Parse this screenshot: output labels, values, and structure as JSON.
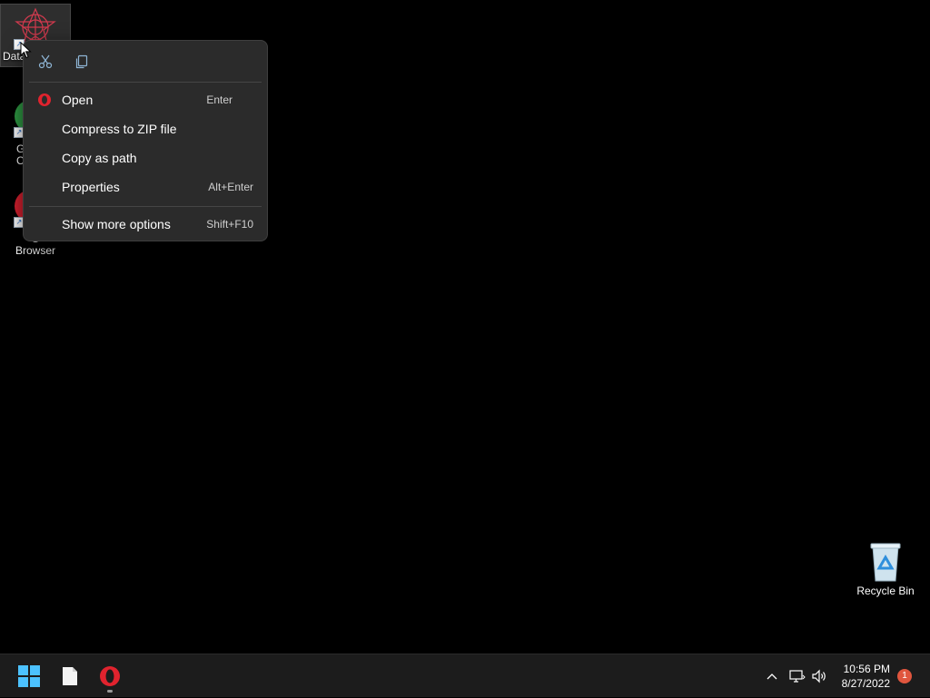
{
  "desktop": {
    "icons": [
      {
        "label": "Data",
        "icon": "datasphere-app-icon",
        "selected": true
      },
      {
        "label": "G\nC",
        "icon": "chrome-app-icon"
      },
      {
        "label": "O\nBrowser",
        "icon": "opera-app-icon"
      }
    ],
    "recycle_bin": {
      "label": "Recycle Bin",
      "icon": "recycle-bin-icon"
    }
  },
  "context_menu": {
    "top_actions": [
      {
        "name": "cut",
        "icon": "scissors-icon"
      },
      {
        "name": "copy",
        "icon": "copy-icon"
      }
    ],
    "items": [
      {
        "label": "Open",
        "shortcut": "Enter",
        "icon": "opera-icon"
      },
      {
        "label": "Compress to ZIP file",
        "shortcut": ""
      },
      {
        "label": "Copy as path",
        "shortcut": ""
      },
      {
        "label": "Properties",
        "shortcut": "Alt+Enter"
      },
      {
        "label": "Show more options",
        "shortcut": "Shift+F10"
      }
    ]
  },
  "taskbar": {
    "apps": [
      {
        "name": "start",
        "icon": "windows-start-icon"
      },
      {
        "name": "file-explorer",
        "icon": "file-icon"
      },
      {
        "name": "opera",
        "icon": "opera-icon",
        "running": true
      }
    ],
    "tray": {
      "icons": [
        "chevron-up-icon",
        "network-icon",
        "volume-icon"
      ],
      "time": "10:56 PM",
      "date": "8/27/2022",
      "notification_count": "1"
    }
  },
  "colors": {
    "desktop_bg": "#000000",
    "menu_bg": "#2b2b2b",
    "taskbar_bg": "#1c1c1c",
    "accent_blue": "#4cc2ff",
    "opera_red": "#e0232e"
  }
}
